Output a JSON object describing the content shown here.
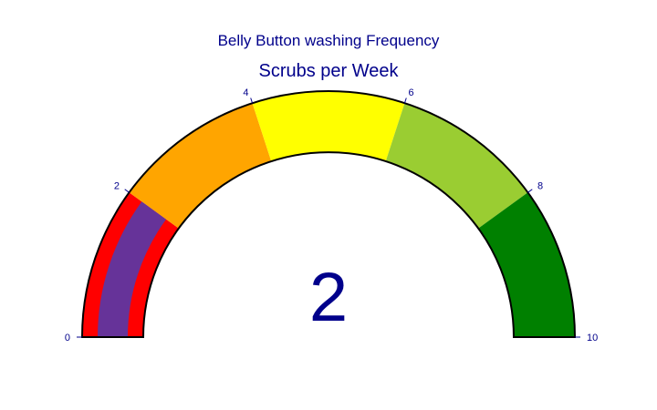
{
  "chart_data": {
    "type": "gauge",
    "title": "Belly Button washing Frequency",
    "subtitle": "Scrubs per Week",
    "value": 2,
    "value_label": "2",
    "range": [
      0,
      10
    ],
    "ticks": [
      {
        "value": 0,
        "label": "0"
      },
      {
        "value": 2,
        "label": "2"
      },
      {
        "value": 4,
        "label": "4"
      },
      {
        "value": 6,
        "label": "6"
      },
      {
        "value": 8,
        "label": "8"
      },
      {
        "value": 10,
        "label": "10"
      }
    ],
    "steps": [
      {
        "range": [
          0,
          2
        ],
        "color": "#ff0000"
      },
      {
        "range": [
          2,
          4
        ],
        "color": "#ffa500"
      },
      {
        "range": [
          4,
          6
        ],
        "color": "#ffff00"
      },
      {
        "range": [
          6,
          8
        ],
        "color": "#9acd32"
      },
      {
        "range": [
          8,
          10
        ],
        "color": "#008000"
      }
    ],
    "bar_color": "#663399",
    "text_color": "#00008b"
  }
}
